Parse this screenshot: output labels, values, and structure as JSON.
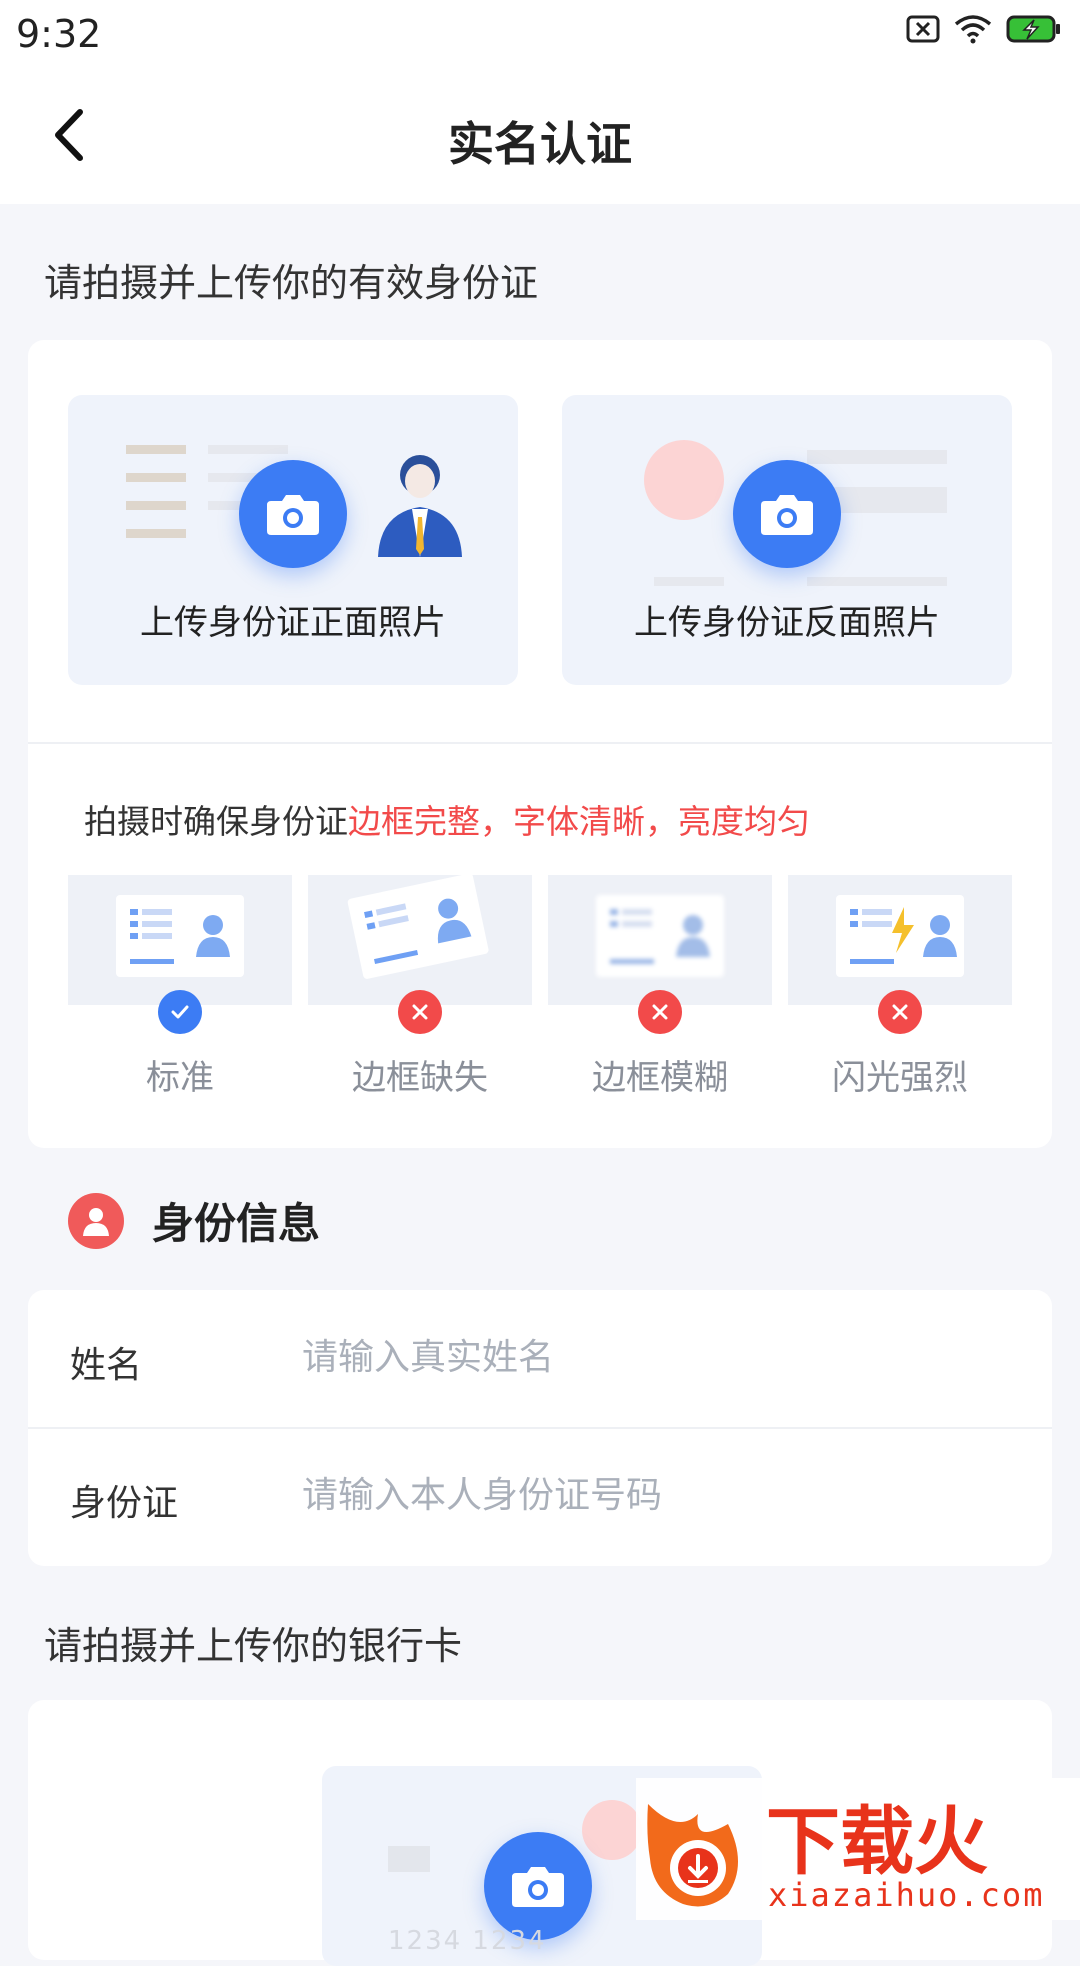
{
  "status_bar": {
    "time": "9:32",
    "icons": [
      "sim-off-icon",
      "wifi-icon",
      "battery-charging-icon"
    ]
  },
  "header": {
    "title": "实名认证",
    "back_icon": "chevron-left-icon"
  },
  "id_card_section": {
    "title": "请拍摄并上传你的有效身份证",
    "front_label": "上传身份证正面照片",
    "back_label": "上传身份证反面照片",
    "hint_prefix": "拍摄时确保身份证",
    "hint_highlight": "边框完整，字体清晰，亮度均匀",
    "samples": [
      {
        "label": "标准",
        "status": "ok"
      },
      {
        "label": "边框缺失",
        "status": "error"
      },
      {
        "label": "边框模糊",
        "status": "error"
      },
      {
        "label": "闪光强烈",
        "status": "error"
      }
    ]
  },
  "identity_info": {
    "title": "身份信息",
    "fields": [
      {
        "label": "姓名",
        "placeholder": "请输入真实姓名",
        "value": ""
      },
      {
        "label": "身份证",
        "placeholder": "请输入本人身份证号码",
        "value": ""
      }
    ]
  },
  "bank_section": {
    "title": "请拍摄并上传你的银行卡",
    "card_number_preview": "1234 1234"
  },
  "watermark": {
    "brand": "下载火",
    "url": "xiazaihuo.com"
  },
  "colors": {
    "accent": "#3c7cf4",
    "error": "#f24a4a",
    "background": "#f5f6fa"
  }
}
